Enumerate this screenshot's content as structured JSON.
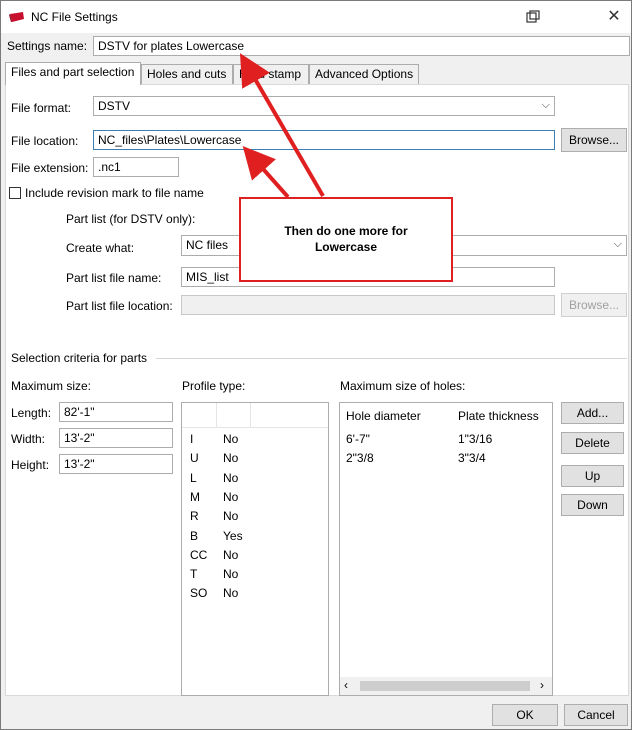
{
  "window": {
    "title": "NC File Settings"
  },
  "settings_name": {
    "label": "Settings name:",
    "value": "DSTV for plates Lowercase"
  },
  "tabs": [
    {
      "label": "Files and part selection",
      "active": true
    },
    {
      "label": "Holes and cuts"
    },
    {
      "label": "Hard stamp"
    },
    {
      "label": "Advanced Options"
    }
  ],
  "file_format": {
    "label": "File format:",
    "value": "DSTV"
  },
  "file_location": {
    "label": "File location:",
    "value": "NC_files\\Plates\\Lowercase",
    "browse": "Browse..."
  },
  "file_extension": {
    "label": "File extension:",
    "value": ".nc1"
  },
  "revision_mark": {
    "label": "Include revision mark to file name",
    "checked": false
  },
  "part_list": {
    "header": "Part list (for DSTV only):",
    "create_what_label": "Create what:",
    "create_what_value": "NC files",
    "file_name_label": "Part list file name:",
    "file_name_value": "MIS_list",
    "file_location_label": "Part list file location:",
    "file_location_value": "",
    "browse": "Browse..."
  },
  "selection": {
    "title": "Selection criteria for parts",
    "max_size_label": "Maximum size:",
    "length_label": "Length:",
    "length_value": "82'-1\"",
    "width_label": "Width:",
    "width_value": "13'-2\"",
    "height_label": "Height:",
    "height_value": "13'-2\"",
    "profile_type_label": "Profile type:",
    "profiles": [
      {
        "type": "I",
        "value": "No"
      },
      {
        "type": "U",
        "value": "No"
      },
      {
        "type": "L",
        "value": "No"
      },
      {
        "type": "M",
        "value": "No"
      },
      {
        "type": "R",
        "value": "No"
      },
      {
        "type": "B",
        "value": "Yes"
      },
      {
        "type": "CC",
        "value": "No"
      },
      {
        "type": "T",
        "value": "No"
      },
      {
        "type": "SO",
        "value": "No"
      }
    ],
    "max_holes_label": "Maximum size of holes:",
    "holes_columns": [
      "Hole diameter",
      "Plate thickness"
    ],
    "holes": [
      {
        "diameter": "6'-7\"",
        "thickness": "1\"3/16"
      },
      {
        "diameter": "2\"3/8",
        "thickness": "3\"3/4"
      }
    ],
    "buttons": {
      "add": "Add...",
      "delete": "Delete",
      "up": "Up",
      "down": "Down"
    }
  },
  "footer": {
    "ok": "OK",
    "cancel": "Cancel"
  },
  "annotation": {
    "text": "Then do one more for\nLowercase",
    "color": "#e02020"
  },
  "icons": {
    "app": "nc-file-icon",
    "restore": "window-restore-icon",
    "close": "close-icon"
  }
}
